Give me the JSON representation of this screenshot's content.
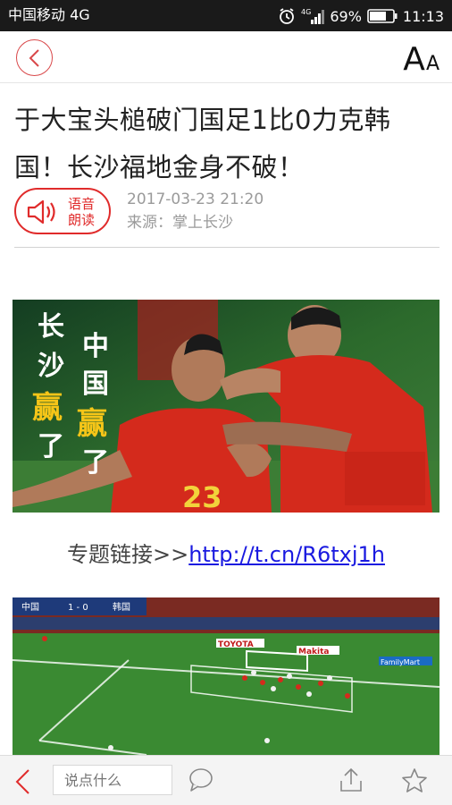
{
  "status_bar": {
    "carrier": "中国移动 4G",
    "network": "4G",
    "battery": "69%",
    "time": "11:13"
  },
  "nav": {
    "font_size_big": "A",
    "font_size_small": "A"
  },
  "article": {
    "title": "于大宝头槌破门国足1比0力克韩国！长沙福地金身不破！",
    "voice_label": "语音朗读",
    "date": "2017-03-23 21:20",
    "source": "来源：掌上长沙",
    "topic_prefix": "专题链接>>",
    "topic_link": "http://t.cn/R6txj1h"
  },
  "photo_1": {
    "overlay_left": "长沙赢了",
    "overlay_right": "中国赢了",
    "jersey_number": "23"
  },
  "photo_2": {
    "score_team_a": "中国",
    "score": "1 - 0",
    "score_team_b": "韩国",
    "board_ads": [
      "TOYOTA",
      "Makita",
      "FamilyMart"
    ]
  },
  "bottom_bar": {
    "comment_placeholder": "说点什么"
  },
  "colors": {
    "accent_red": "#e02b2b",
    "link_blue": "#1a1ae0"
  }
}
